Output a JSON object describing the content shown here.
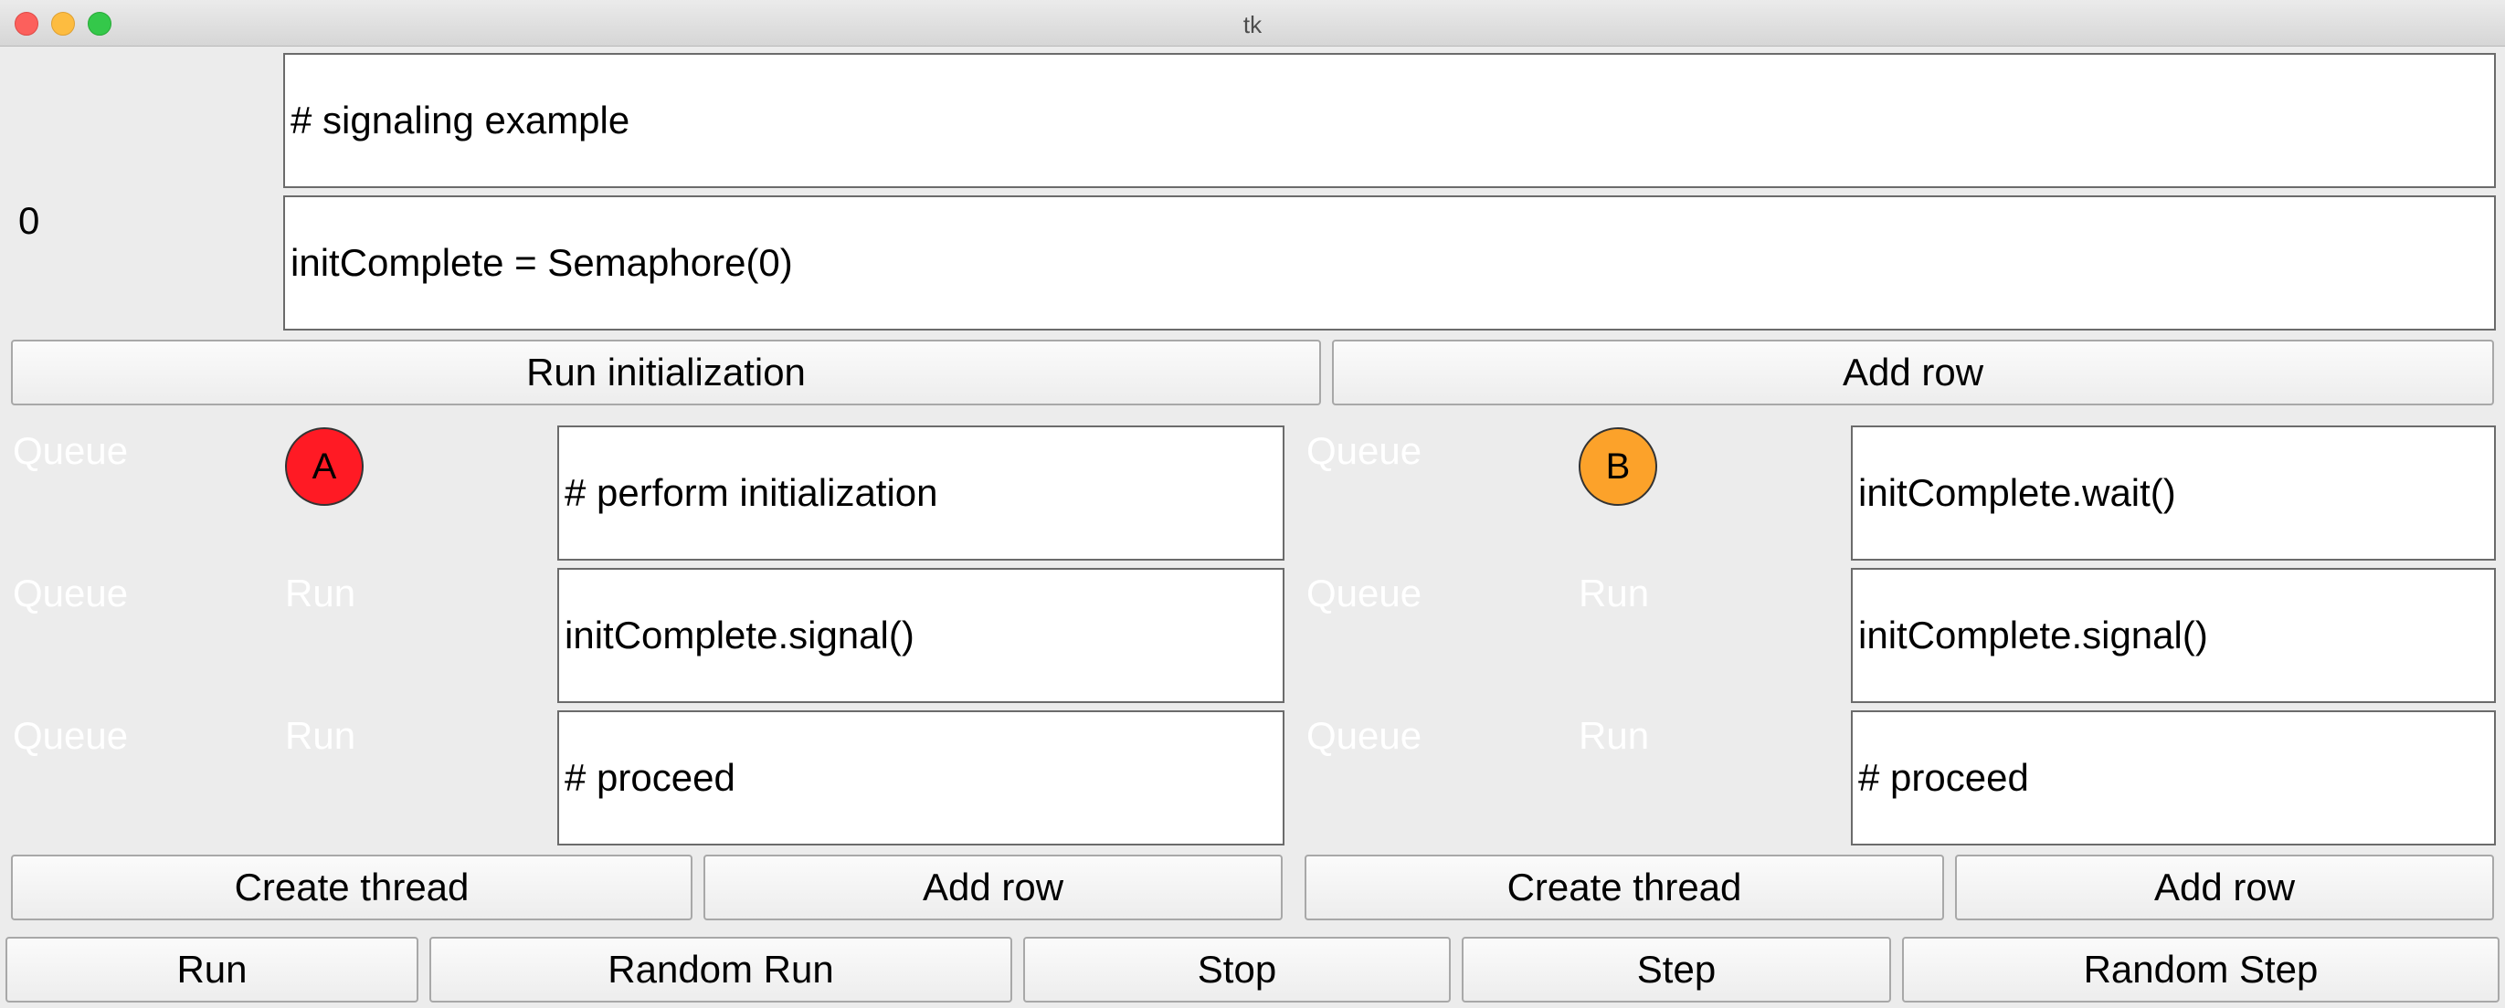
{
  "window": {
    "title": "tk"
  },
  "colors": {
    "thread_a": "#ff1a24",
    "thread_b": "#fca22a"
  },
  "global": {
    "counter": "0",
    "init_lines": [
      "# signaling example",
      "initComplete = Semaphore(0)"
    ],
    "run_initialization_label": "Run initialization",
    "add_row_label": "Add row"
  },
  "threads": [
    {
      "name": "A",
      "queue_labels": [
        "Queue",
        "Queue",
        "Queue"
      ],
      "run_labels": [
        "",
        "Run",
        "Run"
      ],
      "lines": [
        "# perform initialization",
        "initComplete.signal()",
        "# proceed"
      ],
      "create_thread_label": "Create thread",
      "add_row_label": "Add row"
    },
    {
      "name": "B",
      "queue_labels": [
        "Queue",
        "Queue",
        "Queue"
      ],
      "run_labels": [
        "",
        "Run",
        "Run"
      ],
      "lines": [
        "initComplete.wait()",
        "initComplete.signal()",
        "# proceed"
      ],
      "create_thread_label": "Create thread",
      "add_row_label": "Add row"
    }
  ],
  "controls": {
    "run": "Run",
    "random_run": "Random Run",
    "stop": "Stop",
    "step": "Step",
    "random_step": "Random Step"
  }
}
